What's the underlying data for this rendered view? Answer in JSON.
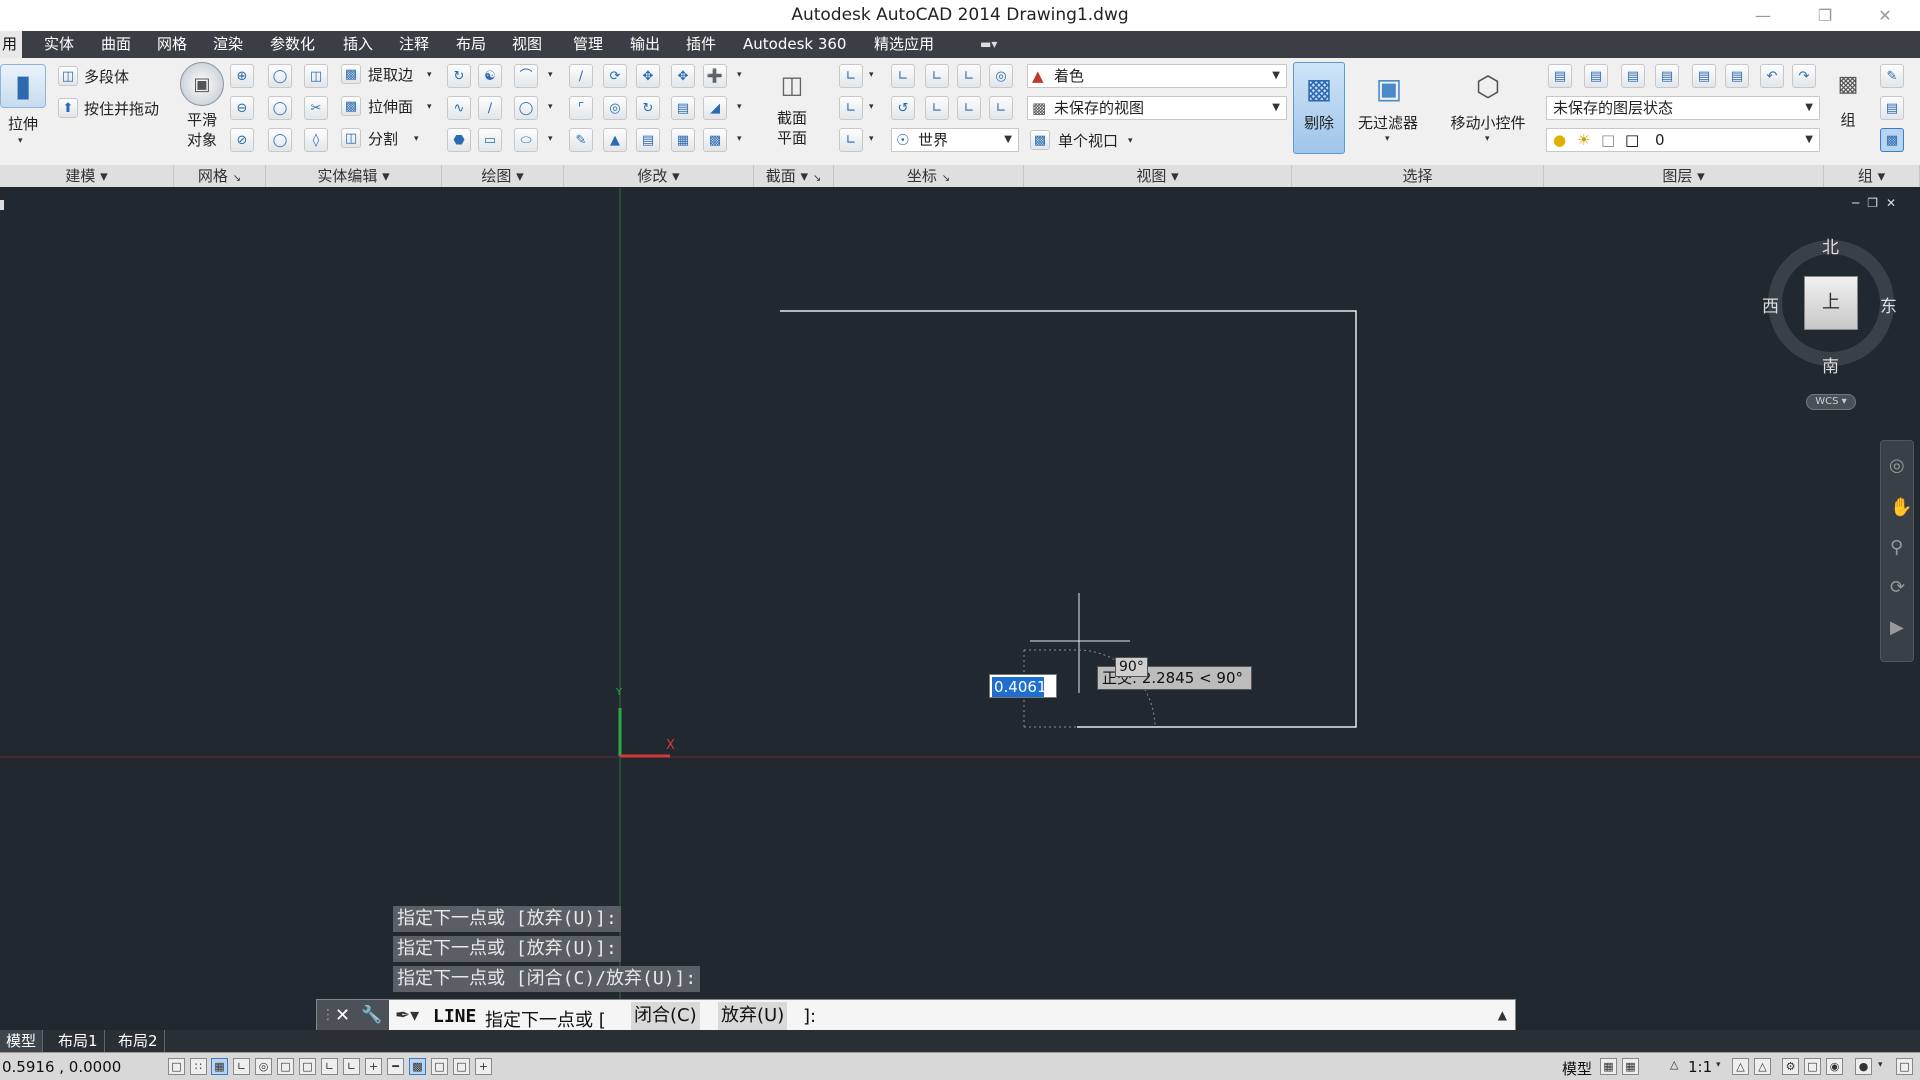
{
  "window": {
    "title": "Autodesk AutoCAD 2014    Drawing1.dwg"
  },
  "tabs": [
    "用",
    "实体",
    "曲面",
    "网格",
    "渲染",
    "参数化",
    "插入",
    "注释",
    "布局",
    "视图",
    "管理",
    "输出",
    "插件",
    "Autodesk 360",
    "精选应用"
  ],
  "ribbon": {
    "modeling": {
      "extrude": "拉伸",
      "polysolid": "多段体",
      "presspull": "按住并拖动",
      "title": "建模"
    },
    "mesh": {
      "smooth_line1": "平滑",
      "smooth_line2": "对象",
      "title": "网格"
    },
    "solidedit": {
      "extract_edges": "提取边",
      "extrude_faces": "拉伸面",
      "split": "分割",
      "title": "实体编辑"
    },
    "draw": {
      "title": "绘图"
    },
    "modify": {
      "title": "修改"
    },
    "section": {
      "plane_line1": "截面",
      "plane_line2": "平面",
      "title": "截面"
    },
    "coords": {
      "world": "世界",
      "title": "坐标"
    },
    "view": {
      "visual_style": "着色",
      "named_view": "未保存的视图",
      "viewports": "单个视口",
      "title": "视图"
    },
    "selection": {
      "culling": "剔除",
      "no_filter": "无过滤器",
      "gizmo": "移动小控件",
      "title": "选择"
    },
    "layers": {
      "layer_state": "未保存的图层状态",
      "current_layer": "0",
      "title": "图层"
    },
    "groups": {
      "group": "组",
      "title": "组"
    }
  },
  "viewcube": {
    "north": "北",
    "south": "南",
    "east": "东",
    "west": "西",
    "top_face": "上",
    "wcs": "WCS"
  },
  "ucs": {
    "y_label": "Y",
    "x_label": "X"
  },
  "dynamic_input": {
    "value": "0.4061",
    "angle": "90°",
    "polar_tooltip": "正交: 2.2845 < 90°"
  },
  "command_history": [
    "指定下一点或 [放弃(U)]:",
    "指定下一点或 [放弃(U)]:",
    "指定下一点或 [闭合(C)/放弃(U)]:"
  ],
  "command_line": {
    "command": "LINE",
    "prompt": "指定下一点或 [",
    "option_close": "闭合(C)",
    "option_undo": "放弃(U)",
    "suffix": "]:"
  },
  "layout_tabs": [
    "模型",
    "布局1",
    "布局2"
  ],
  "status": {
    "coordinates": "0.5916 , 0.0000",
    "model": "模型",
    "scale": "1:1"
  },
  "colors": {
    "canvas": "#212830",
    "ribbon": "#f0f0f0",
    "tabbar": "#3b3f45",
    "accent": "#2d6ab0"
  }
}
